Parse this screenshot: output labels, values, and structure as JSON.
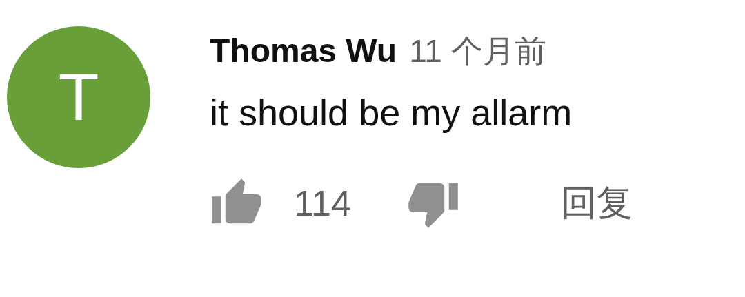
{
  "comment": {
    "avatar_letter": "T",
    "author": "Thomas Wu",
    "time": "11 个月前",
    "text": "it should be my allarm",
    "likes": "114",
    "reply": "回复"
  }
}
